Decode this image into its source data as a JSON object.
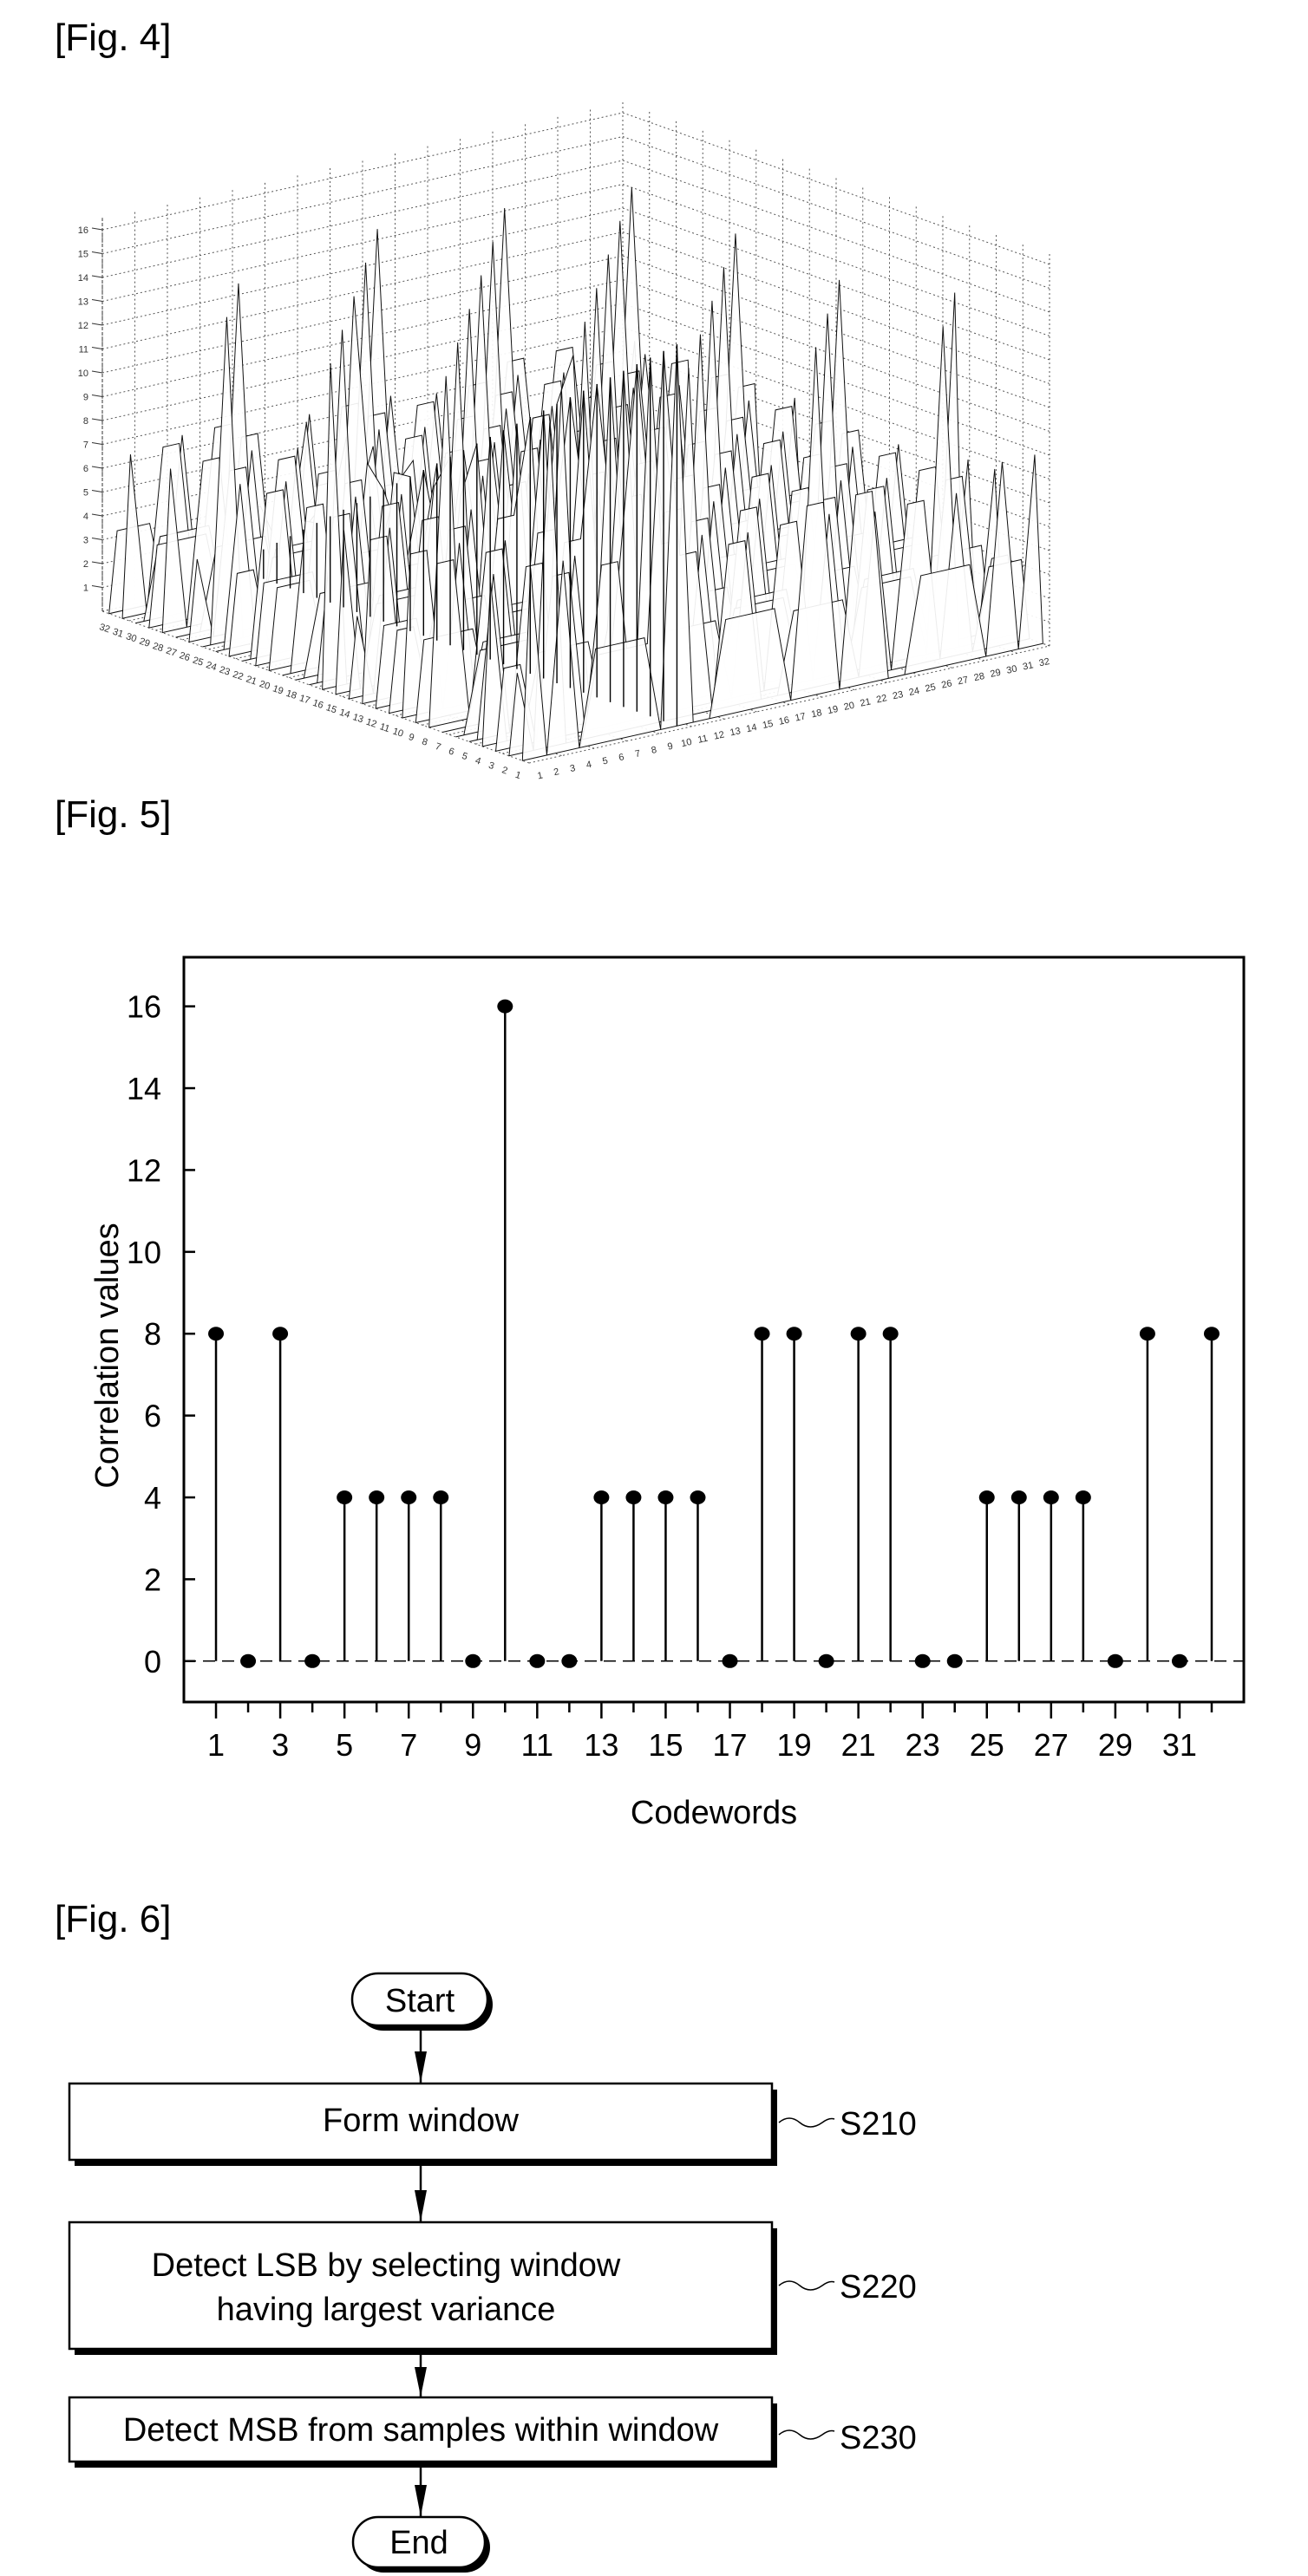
{
  "figures": {
    "fig4": {
      "label": "[Fig. 4]"
    },
    "fig5": {
      "label": "[Fig. 5]"
    },
    "fig6": {
      "label": "[Fig. 6]"
    }
  },
  "fig4_3d": {
    "type": "surface-3d",
    "x_ticks": [
      "1",
      "2",
      "3",
      "4",
      "5",
      "6",
      "7",
      "8",
      "9",
      "10",
      "11",
      "12",
      "13",
      "14",
      "15",
      "16",
      "17",
      "18",
      "19",
      "20",
      "21",
      "22",
      "23",
      "24",
      "25",
      "26",
      "27",
      "28",
      "29",
      "30",
      "31",
      "32"
    ],
    "y_ticks": [
      "1",
      "2",
      "3",
      "4",
      "5",
      "6",
      "7",
      "8",
      "9",
      "10",
      "11",
      "12",
      "13",
      "14",
      "15",
      "16",
      "17",
      "18",
      "19",
      "20",
      "21",
      "22",
      "23",
      "24",
      "25",
      "26",
      "27",
      "28",
      "29",
      "30",
      "31",
      "32"
    ],
    "z_ticks": [
      "1",
      "2",
      "3",
      "4",
      "5",
      "6",
      "7",
      "8",
      "9",
      "10",
      "11",
      "12",
      "13",
      "14",
      "15",
      "16"
    ],
    "z_range": [
      0,
      16
    ],
    "peak": {
      "codeword": 10,
      "value": 16
    }
  },
  "chart_data": {
    "type": "stem",
    "title": "",
    "xlabel": "Codewords",
    "ylabel": "Correlation values",
    "x": [
      1,
      2,
      3,
      4,
      5,
      6,
      7,
      8,
      9,
      10,
      11,
      12,
      13,
      14,
      15,
      16,
      17,
      18,
      19,
      20,
      21,
      22,
      23,
      24,
      25,
      26,
      27,
      28,
      29,
      30,
      31,
      32
    ],
    "values": [
      8,
      0,
      8,
      0,
      4,
      4,
      4,
      4,
      0,
      16,
      0,
      0,
      4,
      4,
      4,
      4,
      0,
      8,
      8,
      0,
      8,
      8,
      0,
      0,
      4,
      4,
      4,
      4,
      0,
      8,
      0,
      8
    ],
    "x_tick_labels": [
      "1",
      "3",
      "5",
      "7",
      "9",
      "11",
      "13",
      "15",
      "17",
      "19",
      "21",
      "23",
      "25",
      "27",
      "29",
      "31"
    ],
    "y_tick_labels": [
      "0",
      "2",
      "4",
      "6",
      "8",
      "10",
      "12",
      "14",
      "16"
    ],
    "xlim": [
      0,
      33
    ],
    "ylim": [
      -1,
      17.2
    ],
    "baseline": 0,
    "baseline_style": "dashed",
    "grid": false,
    "legend": "none"
  },
  "flowchart": {
    "start": "Start",
    "end": "End",
    "steps": [
      {
        "id": "S210",
        "lines": [
          "Form window"
        ]
      },
      {
        "id": "S220",
        "lines": [
          "Detect LSB by selecting window",
          "having largest variance"
        ]
      },
      {
        "id": "S230",
        "lines": [
          "Detect MSB from samples within window"
        ]
      }
    ]
  }
}
